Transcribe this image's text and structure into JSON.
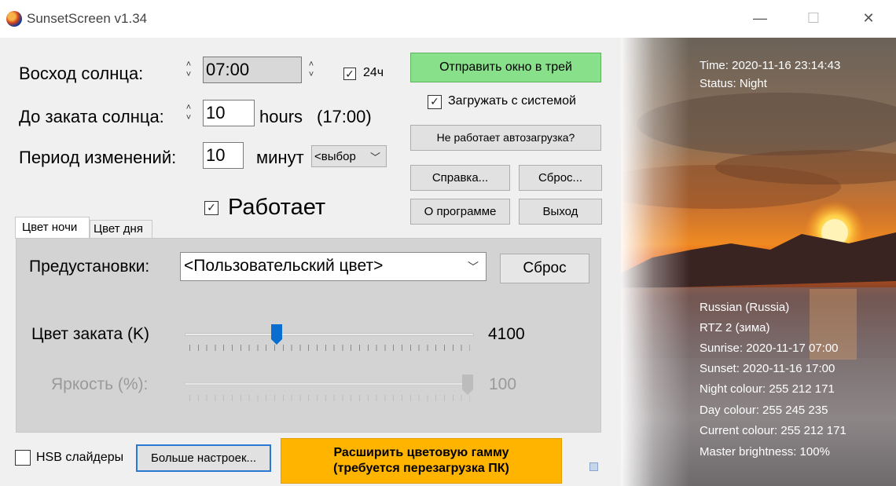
{
  "window": {
    "title": "SunsetScreen v1.34",
    "minimize": "—",
    "maximize": "☐",
    "close": "✕"
  },
  "settings": {
    "sunrise_label": "Восход солнца:",
    "sunrise_value": "07:00",
    "format24_label": "24ч",
    "format24_checked": true,
    "sunset_label": "До заката солнца:",
    "sunset_value": "10",
    "sunset_hours": "hours",
    "sunset_time": "(17:00)",
    "period_label": "Период изменений:",
    "period_value": "10",
    "period_unit": "минут",
    "period_select": "<выбор",
    "working_label": "Работает",
    "working_checked": true
  },
  "buttons": {
    "send_tray": "Отправить окно в трей",
    "autoload_label": "Загружать с системой",
    "autoload_checked": true,
    "autoload_help": "Не работает автозагрузка?",
    "help": "Справка...",
    "reset": "Сброс...",
    "about": "О программе",
    "exit": "Выход"
  },
  "tabs": {
    "night": "Цвет ночи",
    "day": "Цвет дня",
    "active": "night"
  },
  "panel": {
    "presets_label": "Предустановки:",
    "preset_value": "<Пользовательский цвет>",
    "preset_reset": "Сброс",
    "sunset_color_label": "Цвет заката (K)",
    "sunset_color_value": "4100",
    "sunset_color_fraction": 0.31,
    "brightness_label": "Яркость (%):",
    "brightness_value": "100",
    "brightness_fraction": 1.0
  },
  "bottom": {
    "hsb_label": "HSB слайдеры",
    "hsb_checked": false,
    "more_settings": "Больше настроек...",
    "expand_line1": "Расширить цветовую гамму",
    "expand_line2": "(требуется перезагрузка ПК)"
  },
  "info": {
    "time": "Time: 2020-11-16 23:14:43",
    "status": "Status: Night",
    "locale": "Russian (Russia)",
    "timezone": "RTZ 2 (зима)",
    "sunrise": "Sunrise: 2020-11-17 07:00",
    "sunset": "Sunset: 2020-11-16 17:00",
    "night_colour": "Night colour: 255 212 171",
    "day_colour": "Day colour: 255 245 235",
    "current_colour": "Current colour: 255 212 171",
    "master_brightness": "Master brightness: 100%"
  },
  "colors": {
    "accent_green": "#88e08a",
    "accent_orange": "#ffb400",
    "slider_thumb": "#0a6ed1"
  },
  "icons": {
    "app": "sunset-logo-icon",
    "checkbox": "check-icon",
    "dropdown": "chevron-down-icon",
    "spinner": "spin-arrows-icon"
  }
}
